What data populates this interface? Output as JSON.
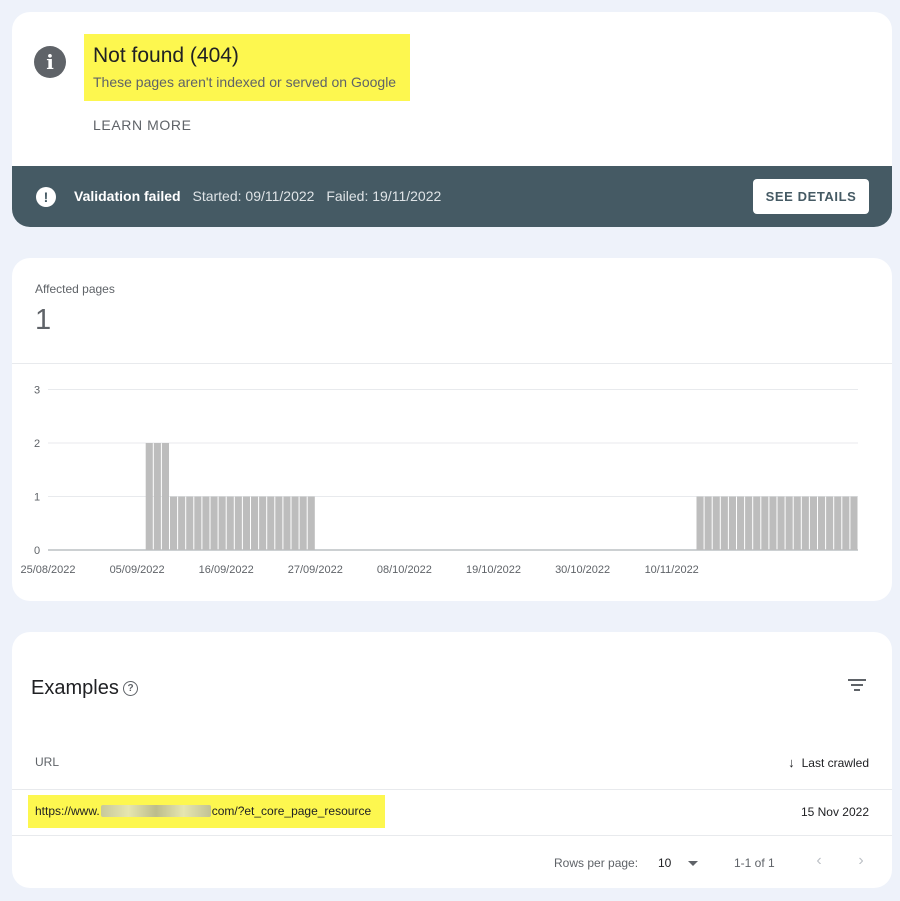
{
  "status_card": {
    "title": "Not found (404)",
    "subtitle": "These pages aren't indexed or served on Google",
    "learn_more": "LEARN MORE",
    "validation": {
      "status": "Validation failed",
      "started": "Started: 09/11/2022",
      "failed": "Failed: 19/11/2022",
      "button": "SEE DETAILS"
    }
  },
  "metric": {
    "label": "Affected pages",
    "value": "1"
  },
  "chart_data": {
    "type": "bar",
    "x_tick_labels": [
      "25/08/2022",
      "05/09/2022",
      "16/09/2022",
      "27/09/2022",
      "08/10/2022",
      "19/10/2022",
      "30/10/2022",
      "10/11/2022"
    ],
    "x_start": "2022-08-25",
    "values": [
      0,
      0,
      0,
      0,
      0,
      0,
      0,
      0,
      0,
      0,
      0,
      0,
      2,
      2,
      2,
      1,
      1,
      1,
      1,
      1,
      1,
      1,
      1,
      1,
      1,
      1,
      1,
      1,
      1,
      1,
      1,
      1,
      1,
      0,
      0,
      0,
      0,
      0,
      0,
      0,
      0,
      0,
      0,
      0,
      0,
      0,
      0,
      0,
      0,
      0,
      0,
      0,
      0,
      0,
      0,
      0,
      0,
      0,
      0,
      0,
      0,
      0,
      0,
      0,
      0,
      0,
      0,
      0,
      0,
      0,
      0,
      0,
      0,
      0,
      0,
      0,
      0,
      0,
      0,
      0,
      1,
      1,
      1,
      1,
      1,
      1,
      1,
      1,
      1,
      1,
      1,
      1,
      1,
      1,
      1,
      1,
      1,
      1,
      1,
      1
    ],
    "y_ticks": [
      0,
      1,
      2,
      3
    ],
    "ylim": [
      0,
      3
    ],
    "grid": true,
    "bar_color": "#bdbdbd"
  },
  "examples": {
    "title": "Examples",
    "col_url": "URL",
    "col_crawled": "Last crawled",
    "rows": [
      {
        "url_prefix": "https://www.",
        "url_suffix": "com/?et_core_page_resource",
        "date": "15 Nov 2022"
      }
    ],
    "rows_per_page_label": "Rows per page:",
    "rows_per_page": "10",
    "range": "1-1 of 1"
  }
}
